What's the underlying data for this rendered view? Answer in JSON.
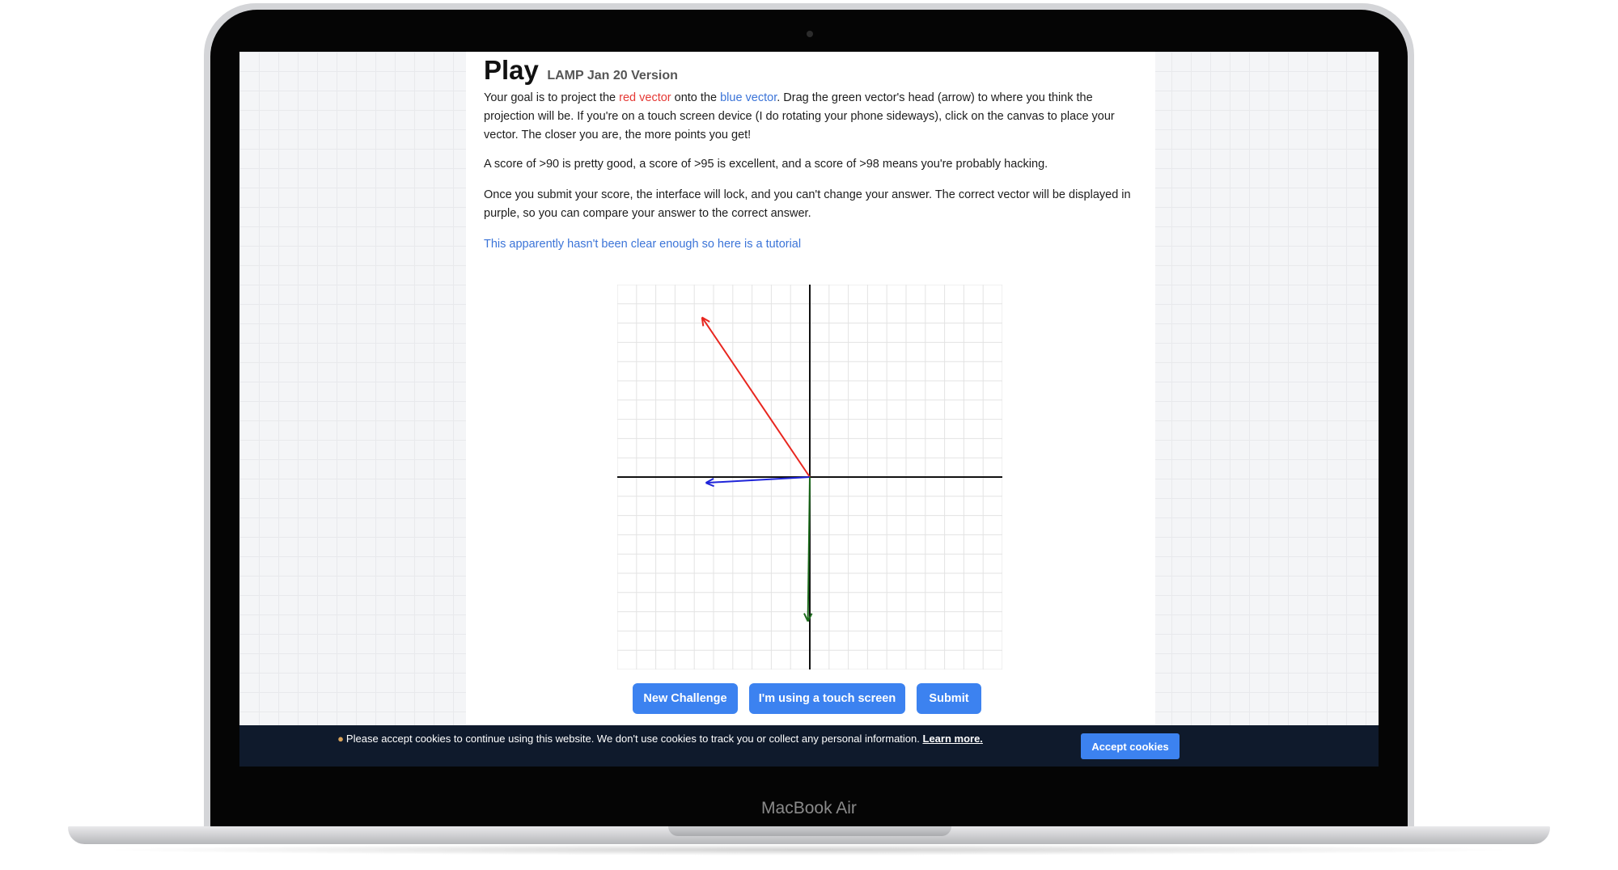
{
  "device": {
    "label": "MacBook Air"
  },
  "page": {
    "title": "Play",
    "subtitle": "LAMP Jan 20 Version",
    "intro": {
      "p1": "Your goal is to project the ",
      "red_vector": "red vector",
      "p2": " onto the ",
      "blue_vector": "blue vector",
      "p3": ". Drag the green vector's head (arrow) to where you think the projection will be. If you're on a touch screen device (I do rotating your phone sideways), click on the canvas to place your vector. The closer you are, the more points you get!"
    },
    "score_info": "A score of >90 is pretty good, a score of >95 is excellent, and a score of >98 means you're probably hacking.",
    "lock_info": "Once you submit your score, the interface will lock, and you can't change your answer. The correct vector will be displayed in purple, so you can compare your answer to the correct answer.",
    "tutorial_link": "This apparently hasn't been clear enough so here is a tutorial"
  },
  "canvas": {
    "range": [
      -10,
      10
    ],
    "grid": true,
    "vectors": [
      {
        "name": "red",
        "color": "#e8261f",
        "x": -5.6,
        "y": 8.3
      },
      {
        "name": "blue",
        "color": "#1f25d9",
        "x": -5.4,
        "y": -0.3
      },
      {
        "name": "green",
        "color": "#1c6b1c",
        "x": -0.1,
        "y": -7.5
      }
    ]
  },
  "buttons": {
    "new_challenge": "New Challenge",
    "touch_screen": "I'm using a touch screen",
    "submit": "Submit"
  },
  "cookie": {
    "icon": "cookie-icon",
    "message": "Please accept cookies to continue using this website. We don't use cookies to track you or collect any personal information. ",
    "learn_more": "Learn more.",
    "accept": "Accept cookies"
  },
  "colors": {
    "accent": "#3c82f0",
    "cookie_bar": "#0f1a2c",
    "red_text": "#e53935",
    "blue_text": "#3b74d8"
  }
}
